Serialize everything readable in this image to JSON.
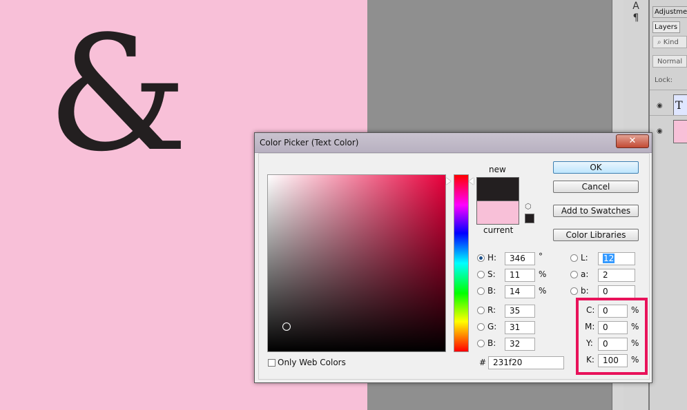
{
  "document": {
    "glyph": "&"
  },
  "side_panel": {
    "tabs": [
      "Adjustme",
      "Layers"
    ],
    "kind_placeholder": "Kind",
    "blend_mode": "Normal",
    "lock_label": "Lock:",
    "layer_text_thumb": "T"
  },
  "dialog": {
    "title": "Color Picker (Text Color)",
    "close_glyph": "✕",
    "new_label": "new",
    "current_label": "current",
    "buttons": {
      "ok": "OK",
      "cancel": "Cancel",
      "add_swatches": "Add to Swatches",
      "libraries": "Color Libraries"
    },
    "fields": {
      "H": {
        "label": "H:",
        "value": "346",
        "unit": "°"
      },
      "S": {
        "label": "S:",
        "value": "11",
        "unit": "%"
      },
      "Bv": {
        "label": "B:",
        "value": "14",
        "unit": "%"
      },
      "R": {
        "label": "R:",
        "value": "35"
      },
      "G": {
        "label": "G:",
        "value": "31"
      },
      "Bl": {
        "label": "B:",
        "value": "32"
      },
      "L": {
        "label": "L:",
        "value": "12"
      },
      "a": {
        "label": "a:",
        "value": "2"
      },
      "b": {
        "label": "b:",
        "value": "0"
      },
      "C": {
        "label": "C:",
        "value": "0",
        "unit": "%"
      },
      "M": {
        "label": "M:",
        "value": "0",
        "unit": "%"
      },
      "Y": {
        "label": "Y:",
        "value": "0",
        "unit": "%"
      },
      "K": {
        "label": "K:",
        "value": "100",
        "unit": "%"
      }
    },
    "hex_label": "#",
    "hex_value": "231f20",
    "only_web_colors": "Only Web Colors"
  },
  "colors": {
    "new_color": "#231f20",
    "current_color": "#f8c0d8",
    "highlight": "#e8125a"
  }
}
